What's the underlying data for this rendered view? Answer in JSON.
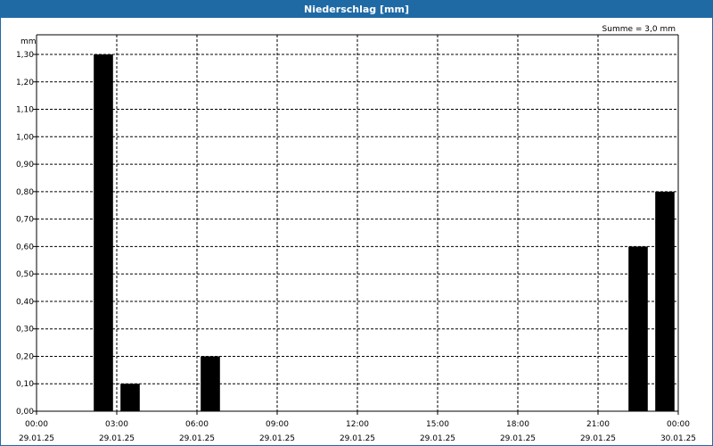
{
  "window": {
    "title": "Niederschlag [mm]"
  },
  "colors": {
    "titlebar": "#1f6aa5",
    "bar": "#000000",
    "grid": "#000000"
  },
  "summary": "Summe = 3,0 mm",
  "chart_data": {
    "type": "bar",
    "title": "Niederschlag [mm]",
    "ylabel": "mm",
    "xlabel": "",
    "ylim": [
      0,
      1.3
    ],
    "grid": true,
    "y_ticks": [
      "0,00",
      "0,10",
      "0,20",
      "0,30",
      "0,40",
      "0,50",
      "0,60",
      "0,70",
      "0,80",
      "0,90",
      "1,00",
      "1,10",
      "1,20",
      "1,30"
    ],
    "x_range_hours": [
      0,
      24
    ],
    "x_ticks": [
      {
        "time": "00:00",
        "date": "29.01.25"
      },
      {
        "time": "03:00",
        "date": "29.01.25"
      },
      {
        "time": "06:00",
        "date": "29.01.25"
      },
      {
        "time": "09:00",
        "date": "29.01.25"
      },
      {
        "time": "12:00",
        "date": "29.01.25"
      },
      {
        "time": "15:00",
        "date": "29.01.25"
      },
      {
        "time": "18:00",
        "date": "29.01.25"
      },
      {
        "time": "21:00",
        "date": "29.01.25"
      },
      {
        "time": "00:00",
        "date": "30.01.25"
      }
    ],
    "bars": [
      {
        "interval": "02:00-03:00",
        "start_hour": 2,
        "value": 1.3
      },
      {
        "interval": "03:00-04:00",
        "start_hour": 3,
        "value": 0.1
      },
      {
        "interval": "06:00-07:00",
        "start_hour": 6,
        "value": 0.2
      },
      {
        "interval": "22:00-23:00",
        "start_hour": 22,
        "value": 0.6
      },
      {
        "interval": "23:00-00:00",
        "start_hour": 23,
        "value": 0.8
      }
    ]
  }
}
